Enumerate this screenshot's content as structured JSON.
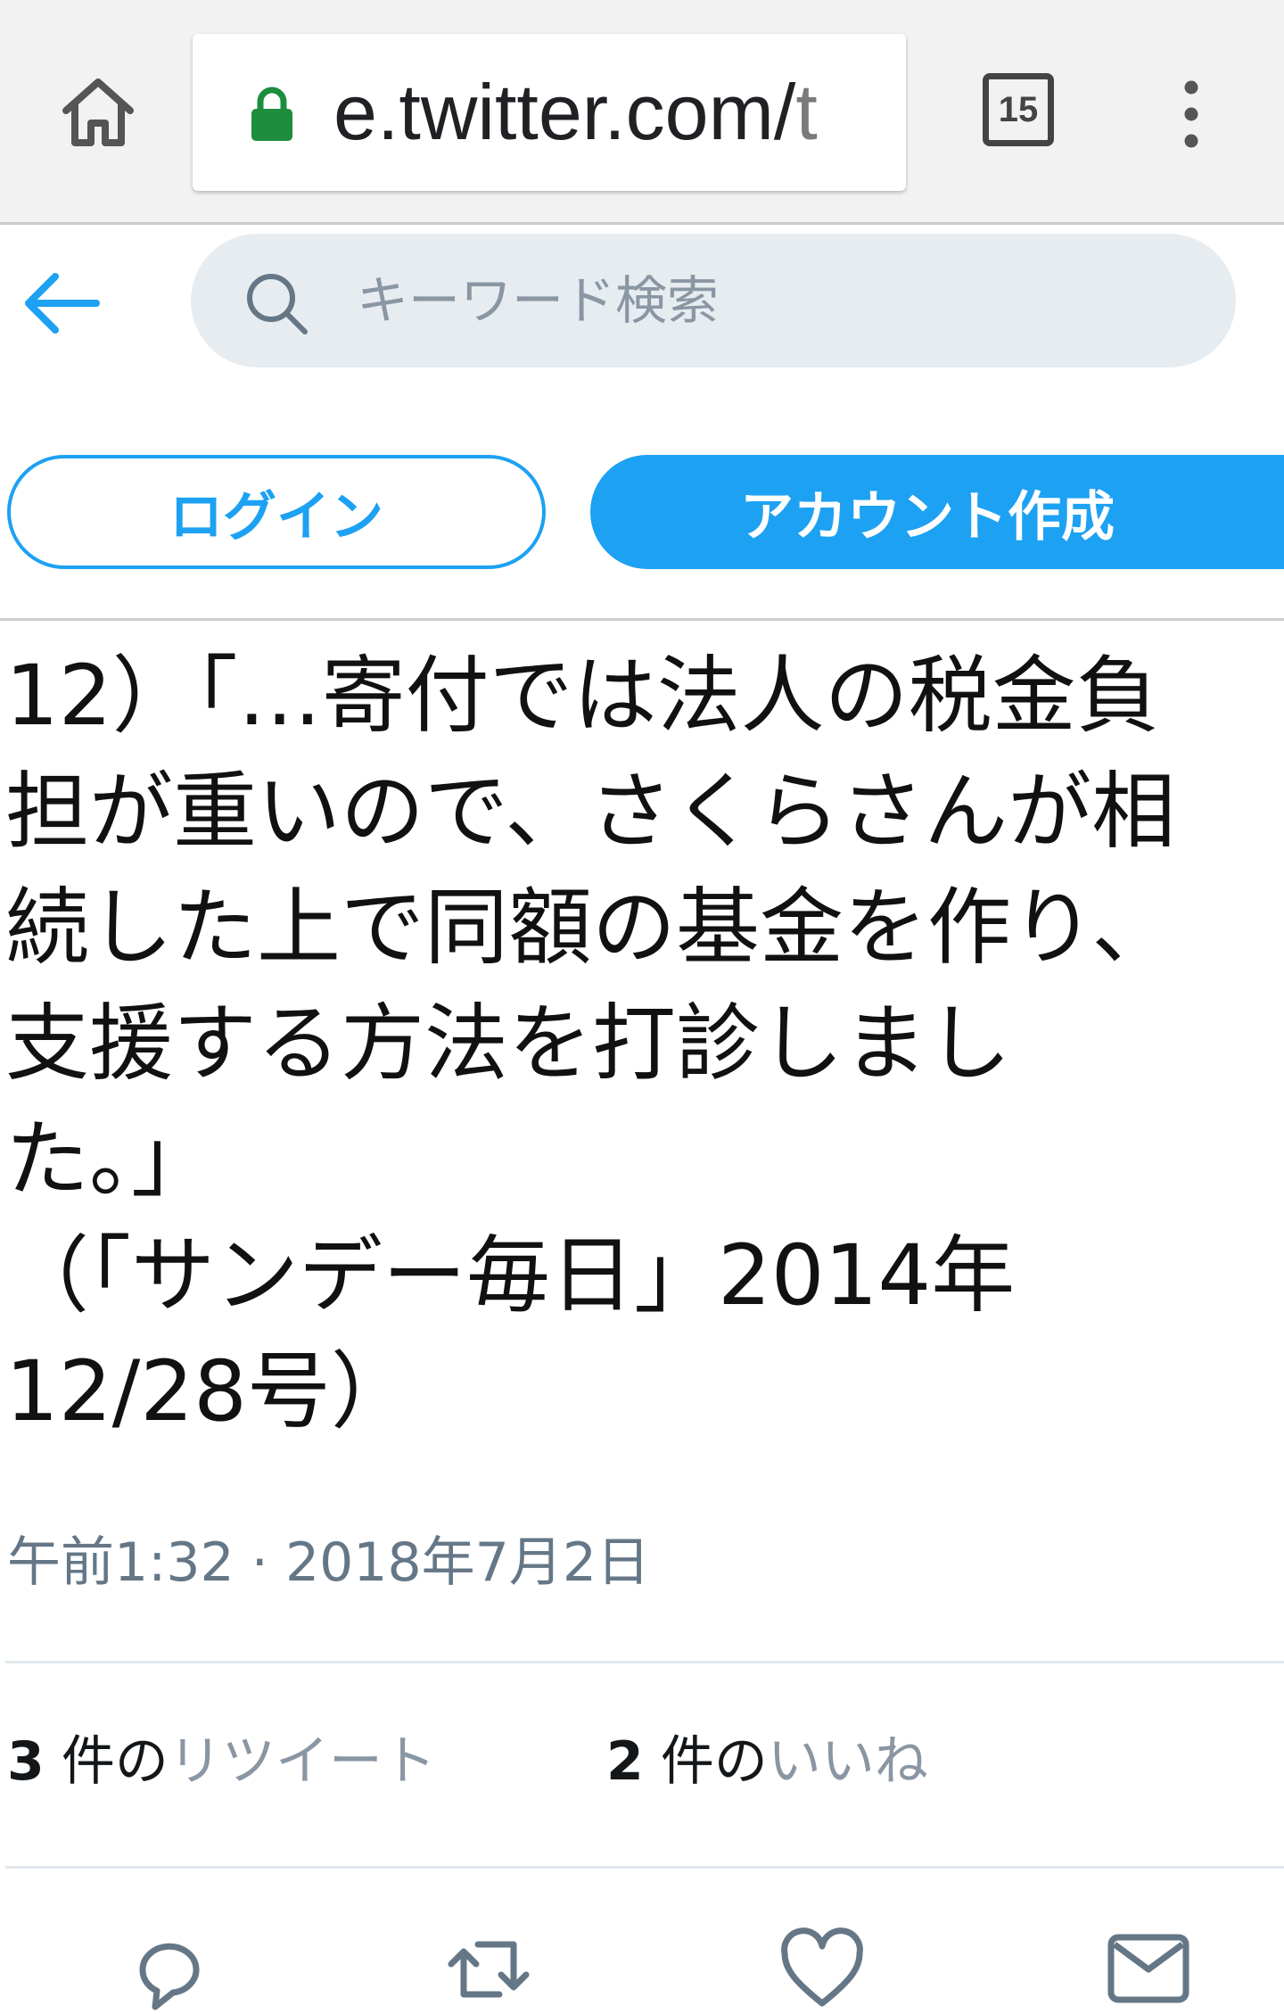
{
  "browser": {
    "url_host": "e.twitter.com/",
    "url_rest": "t",
    "tab_count": "15",
    "icons": {
      "home": "home-icon",
      "lock": "lock-icon",
      "tabs": "tab-switcher-icon",
      "menu": "more-vertical-icon"
    },
    "lock_color": "#1e8e3e"
  },
  "header": {
    "search_placeholder": "キーワード検索",
    "icons": {
      "back": "back-arrow-icon",
      "search": "search-icon"
    },
    "accent_color": "#1da1f2"
  },
  "auth": {
    "login_label": "ログイン",
    "signup_label": "アカウント作成"
  },
  "tweet": {
    "text": "12）「…寄付では法人の税金負\n担が重いので、さくらさんが相\n続した上で同額の基金を作り、\n支援する方法を打診しまし\nた。」\n（「サンデー毎日」2014年\n12/28号）",
    "timestamp": "午前1:32 · 2018年7月2日",
    "retweets": {
      "count": "3",
      "unit": " 件の",
      "label": "リツイート"
    },
    "likes": {
      "count": "2",
      "unit": " 件の",
      "label": "いいね"
    }
  },
  "actions": [
    {
      "icon": "reply-icon"
    },
    {
      "icon": "retweet-icon"
    },
    {
      "icon": "like-icon"
    },
    {
      "icon": "direct-message-icon"
    }
  ]
}
